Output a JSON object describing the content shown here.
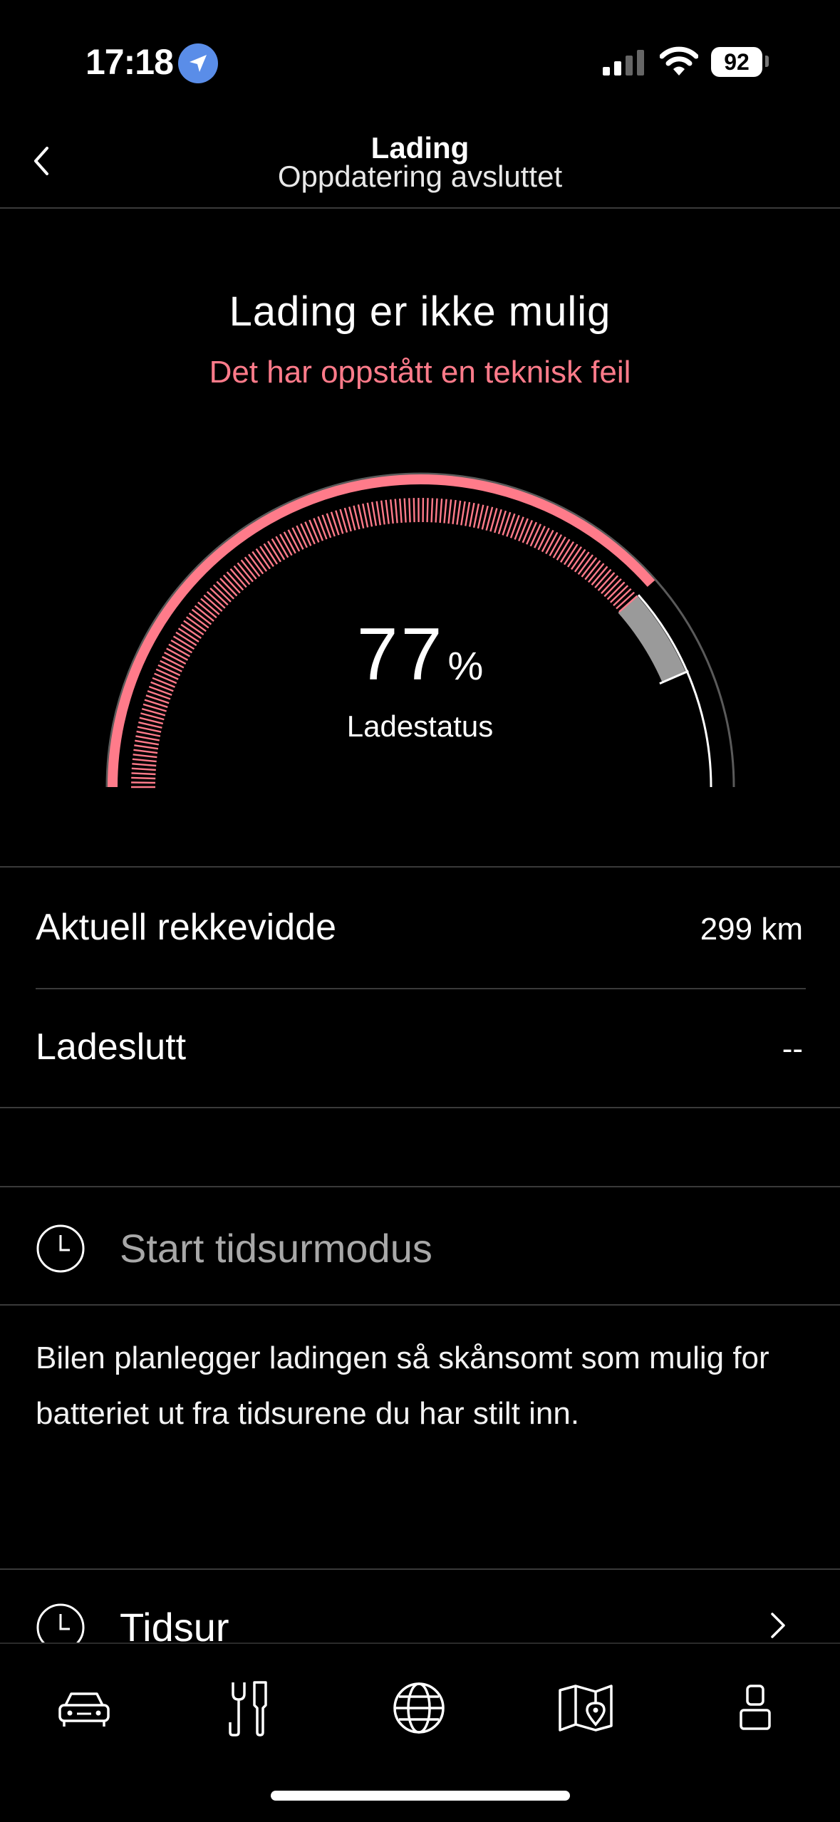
{
  "status_bar": {
    "time": "17:18",
    "battery": "92",
    "icons": [
      "location-icon",
      "signal-icon",
      "wifi-icon",
      "battery-icon"
    ]
  },
  "header": {
    "title": "Lading",
    "subtitle": "Oppdatering avsluttet",
    "back_icon": "chevron-left-icon"
  },
  "charging": {
    "title": "Lading er ikke mulig",
    "error": "Det har oppstått en teknisk feil",
    "percent": "77",
    "percent_unit": "%",
    "percent_label": "Ladestatus",
    "level": 0.77,
    "target_level": 0.87
  },
  "details": [
    {
      "label": "Aktuell rekkevidde",
      "value": "299 km"
    },
    {
      "label": "Ladeslutt",
      "value": "--"
    }
  ],
  "timer_mode": {
    "label": "Start tidsurmodus",
    "description": "Bilen planlegger ladingen så skånsomt som mulig for batteriet ut fra tidsurene du har stilt inn."
  },
  "timer_link": {
    "label": "Tidsur"
  },
  "tabs": [
    {
      "icon": "car-icon"
    },
    {
      "icon": "tools-icon"
    },
    {
      "icon": "globe-icon"
    },
    {
      "icon": "map-icon"
    },
    {
      "icon": "profile-icon"
    }
  ],
  "colors": {
    "accent": "#ff7b8a",
    "background": "#000000",
    "gauge_target": "#9a9a9a"
  }
}
